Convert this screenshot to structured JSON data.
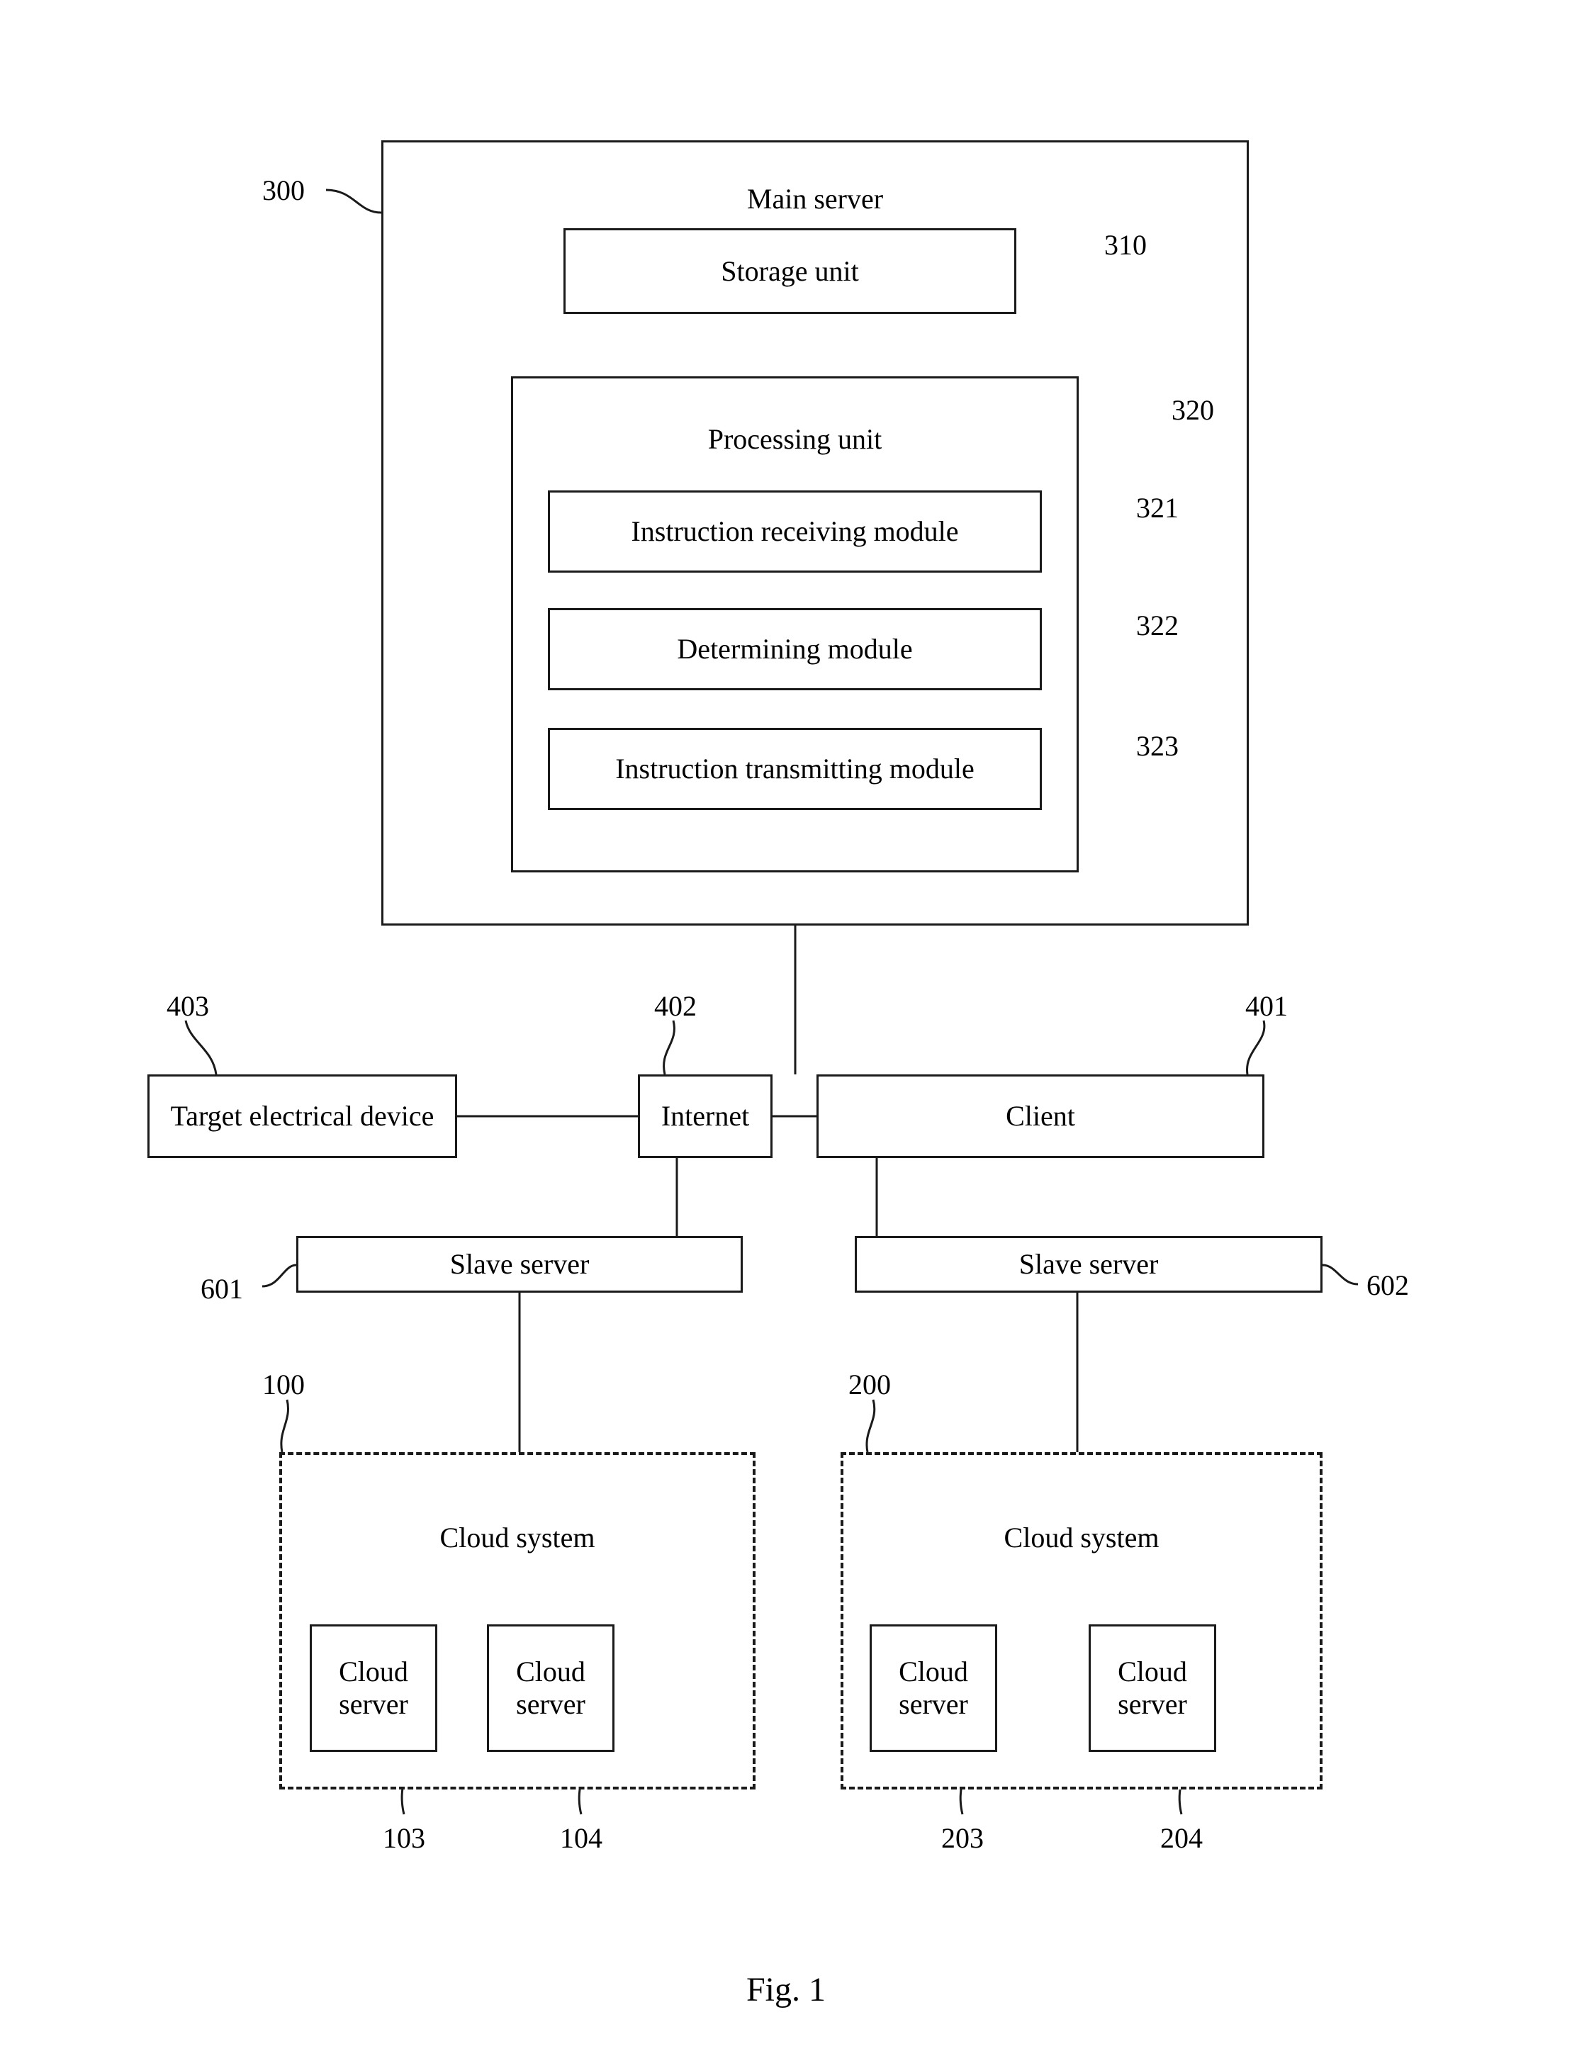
{
  "figure": {
    "caption": "Fig. 1"
  },
  "main_server": {
    "title": "Main server",
    "ref": "300",
    "storage_unit": {
      "label": "Storage unit",
      "ref": "310"
    },
    "processing_unit": {
      "label": "Processing unit",
      "ref": "320",
      "modules": [
        {
          "label": "Instruction receiving module",
          "ref": "321"
        },
        {
          "label": "Determining module",
          "ref": "322"
        },
        {
          "label": "Instruction transmitting module",
          "ref": "323"
        }
      ]
    }
  },
  "network_row": {
    "target_device": {
      "label": "Target electrical device",
      "ref": "403"
    },
    "internet": {
      "label": "Internet",
      "ref": "402"
    },
    "client": {
      "label": "Client",
      "ref": "401"
    }
  },
  "slave_servers": [
    {
      "label": "Slave server",
      "ref": "601"
    },
    {
      "label": "Slave server",
      "ref": "602"
    }
  ],
  "cloud_systems": [
    {
      "label": "Cloud system",
      "ref": "100",
      "servers": [
        {
          "label": "Cloud\nserver",
          "ref": "103"
        },
        {
          "label": "Cloud\nserver",
          "ref": "104"
        }
      ]
    },
    {
      "label": "Cloud system",
      "ref": "200",
      "servers": [
        {
          "label": "Cloud\nserver",
          "ref": "203"
        },
        {
          "label": "Cloud\nserver",
          "ref": "204"
        }
      ]
    }
  ],
  "colors": {
    "stroke": "#1a1a1a",
    "background": "#ffffff"
  }
}
